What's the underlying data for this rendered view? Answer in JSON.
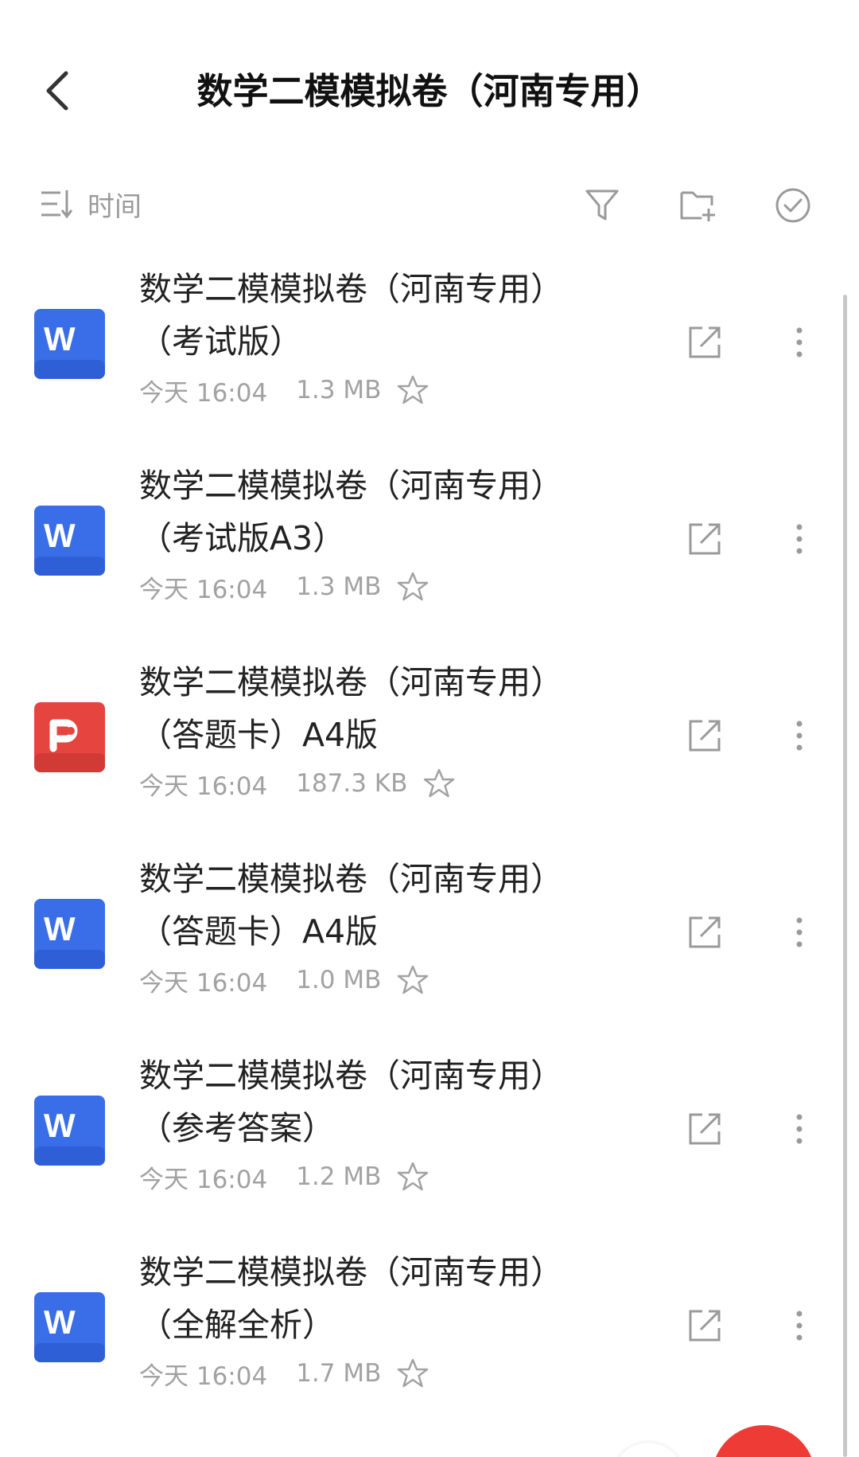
{
  "header": {
    "title": "数学二模模拟卷（河南专用）",
    "back_icon": "chevron-left-icon"
  },
  "toolbar": {
    "sort_label": "时间",
    "sort_icon": "sort-icon",
    "filter_icon": "filter-icon",
    "new_folder_icon": "folder-add-icon",
    "select_icon": "check-circle-icon"
  },
  "colors": {
    "word_blue": "#3a6ee8",
    "pdf_red": "#e5443f",
    "fab_red": "#ef3b35",
    "meta_gray": "#a2a2a2"
  },
  "files": [
    {
      "name_line1": "数学二模模拟卷（河南专用）",
      "name_line2": "（考试版）",
      "date": "今天 16:04",
      "size": "1.3 MB",
      "type": "W"
    },
    {
      "name_line1": "数学二模模拟卷（河南专用）",
      "name_line2": "（考试版A3）",
      "date": "今天 16:04",
      "size": "1.3 MB",
      "type": "W"
    },
    {
      "name_line1": "数学二模模拟卷（河南专用）",
      "name_line2": "（答题卡）A4版",
      "date": "今天 16:04",
      "size": "187.3 KB",
      "type": "P"
    },
    {
      "name_line1": "数学二模模拟卷（河南专用）",
      "name_line2": "（答题卡）A4版",
      "date": "今天 16:04",
      "size": "1.0 MB",
      "type": "W"
    },
    {
      "name_line1": "数学二模模拟卷（河南专用）",
      "name_line2": "（参考答案）",
      "date": "今天 16:04",
      "size": "1.2 MB",
      "type": "W"
    },
    {
      "name_line1": "数学二模模拟卷（河南专用）",
      "name_line2": "（全解全析）",
      "date": "今天 16:04",
      "size": "1.7 MB",
      "type": "W"
    }
  ]
}
